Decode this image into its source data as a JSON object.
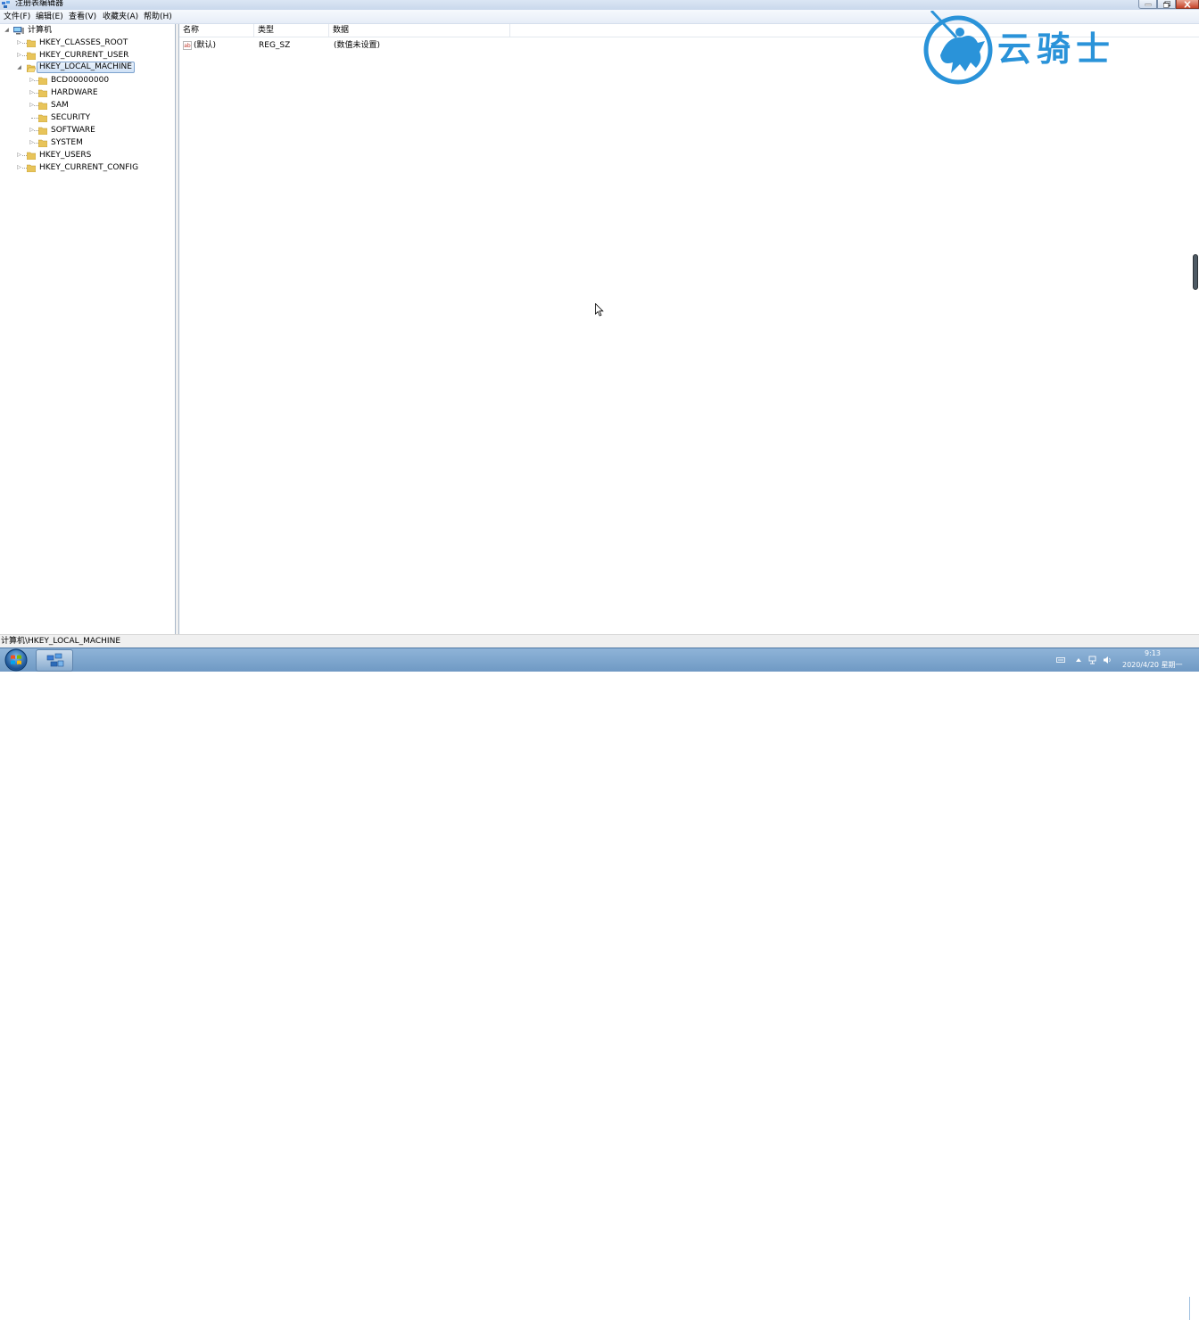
{
  "window": {
    "title": "注册表编辑器"
  },
  "menu": [
    "文件(F)",
    "编辑(E)",
    "查看(V)",
    "收藏夹(A)",
    "帮助(H)"
  ],
  "tree": {
    "root": "计算机",
    "items": [
      {
        "label": "HKEY_CLASSES_ROOT"
      },
      {
        "label": "HKEY_CURRENT_USER"
      },
      {
        "label": "HKEY_LOCAL_MACHINE",
        "selected": true
      },
      {
        "label": "BCD00000000"
      },
      {
        "label": "HARDWARE"
      },
      {
        "label": "SAM"
      },
      {
        "label": "SECURITY"
      },
      {
        "label": "SOFTWARE"
      },
      {
        "label": "SYSTEM"
      },
      {
        "label": "HKEY_USERS"
      },
      {
        "label": "HKEY_CURRENT_CONFIG"
      }
    ]
  },
  "list": {
    "columns": [
      "名称",
      "类型",
      "数据"
    ],
    "rows": [
      {
        "name": "(默认)",
        "type": "REG_SZ",
        "data": "(数值未设置)"
      }
    ]
  },
  "watermark": {
    "text": "云骑士",
    "color": "#2a93d9"
  },
  "status": {
    "path": "计算机\\HKEY_LOCAL_MACHINE"
  },
  "taskbar": {
    "time": "9:13",
    "date": "2020/4/20 星期一"
  },
  "icons": {
    "app": "regedit-icon",
    "computer": "computer-icon",
    "folder": "folder-icon",
    "value": "string-value-icon",
    "start": "start-orb-icon"
  }
}
